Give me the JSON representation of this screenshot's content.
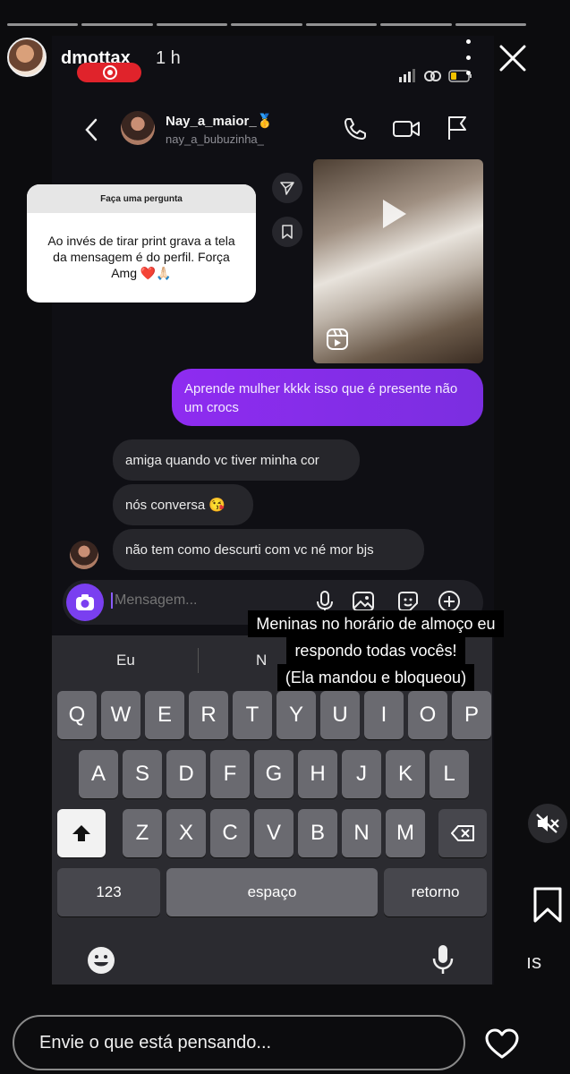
{
  "story": {
    "username": "dmottax",
    "time": "1 h",
    "progress_segments": 7
  },
  "dm": {
    "contact_name": "Nay_a_maior_🥇",
    "contact_handle": "nay_a_bubuzinha_",
    "question_card": {
      "header": "Faça uma pergunta",
      "text": "Ao invés de tirar print grava a tela da mensagem é do perfil. Força Amg ❤️🙏🏻"
    },
    "messages": [
      {
        "from": "me",
        "text": "Aprende mulher kkkk isso que é presente não um crocs"
      },
      {
        "from": "them",
        "text": "amiga quando vc tiver minha cor"
      },
      {
        "from": "them",
        "text": "nós conversa 😘"
      },
      {
        "from": "them",
        "text": "não tem como descurti com vc né mor bjs"
      }
    ],
    "composer_placeholder": "Mensagem..."
  },
  "keyboard": {
    "suggestions": [
      "Eu",
      "N"
    ],
    "row1": [
      "Q",
      "W",
      "E",
      "R",
      "T",
      "Y",
      "U",
      "I",
      "O",
      "P"
    ],
    "row2": [
      "A",
      "S",
      "D",
      "F",
      "G",
      "H",
      "J",
      "K",
      "L"
    ],
    "row3": [
      "Z",
      "X",
      "C",
      "V",
      "B",
      "N",
      "M"
    ],
    "numbers_label": "123",
    "space_label": "espaço",
    "return_label": "retorno"
  },
  "caption": {
    "lines": [
      "Meninas no horário de almoço eu",
      "respondo todas vocês!",
      "(Ela mandou e bloqueou)"
    ]
  },
  "side_text": "ıs",
  "reply_placeholder": "Envie o que está pensando...",
  "colors": {
    "outgoing_bubble": "#8a2be2",
    "camera_button": "#7a3ff0",
    "recording_badge": "#e0232b"
  }
}
